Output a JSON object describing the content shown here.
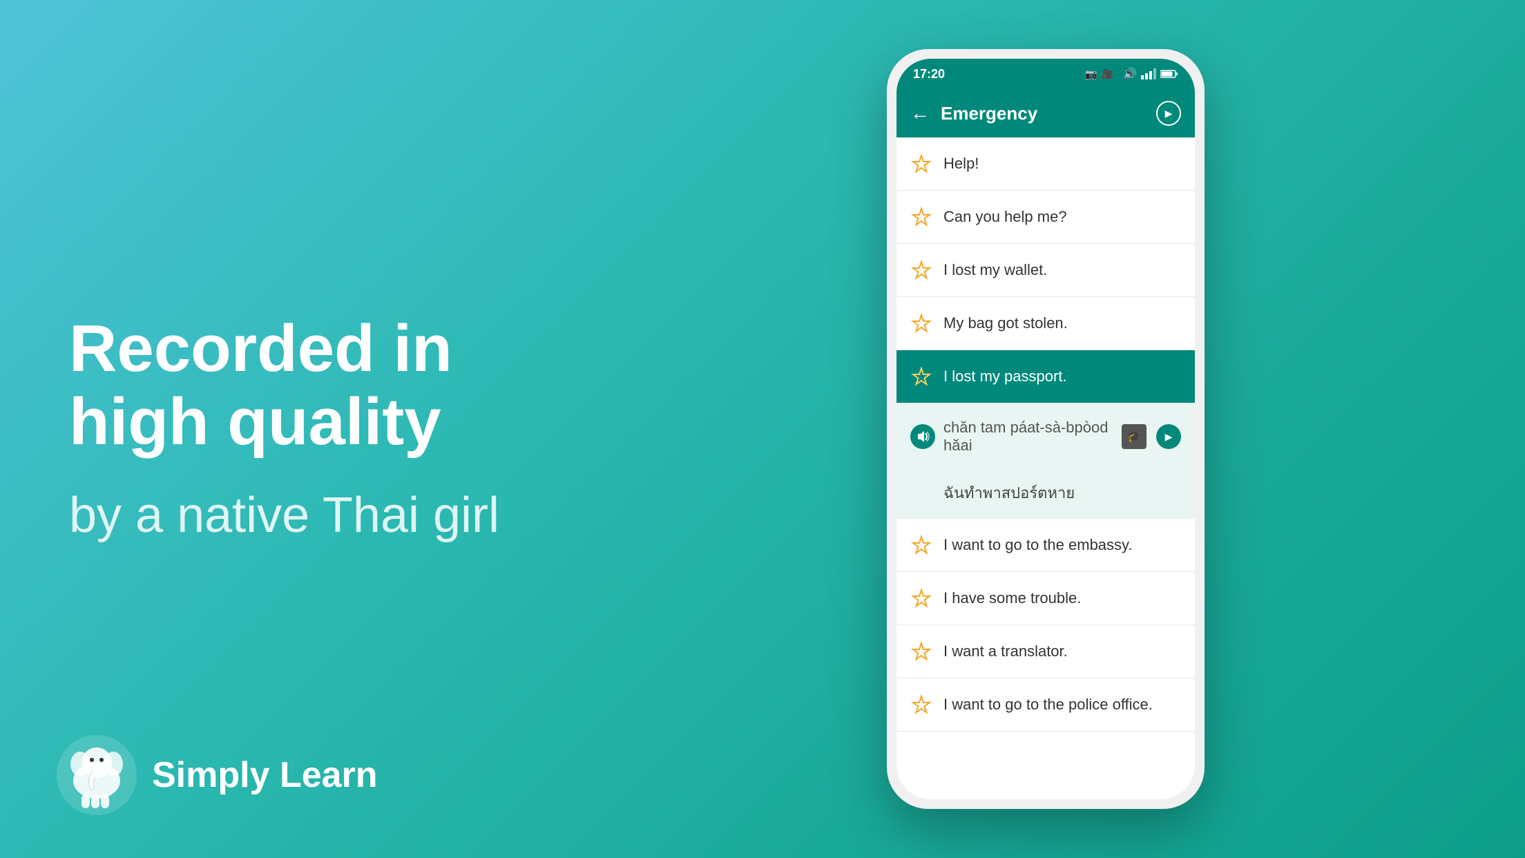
{
  "background": {
    "gradient_start": "#4fc3d8",
    "gradient_end": "#0d9e8a"
  },
  "left_panel": {
    "main_title": "Recorded in\nhigh quality",
    "subtitle": "by a native Thai girl",
    "logo_text": "Simply Learn"
  },
  "phone": {
    "status_bar": {
      "time": "17:20"
    },
    "header": {
      "title": "Emergency",
      "back_label": "←",
      "play_label": "▶"
    },
    "phrases": [
      {
        "id": 1,
        "text": "Help!",
        "starred": true,
        "active": false
      },
      {
        "id": 2,
        "text": "Can you help me?",
        "starred": true,
        "active": false
      },
      {
        "id": 3,
        "text": "I lost my wallet.",
        "starred": true,
        "active": false
      },
      {
        "id": 4,
        "text": "My bag got stolen.",
        "starred": true,
        "active": false
      },
      {
        "id": 5,
        "text": "I lost my passport.",
        "starred": true,
        "active": true
      },
      {
        "id": 6,
        "pronunciation": "chăn tam páat-sà-bpòod hăai",
        "thai": "ฉันทำพาสปอร์ตหาย",
        "expanded": true
      },
      {
        "id": 7,
        "text": "I want to go to the embassy.",
        "starred": true,
        "active": false
      },
      {
        "id": 8,
        "text": "I have some trouble.",
        "starred": true,
        "active": false
      },
      {
        "id": 9,
        "text": "I want a translator.",
        "starred": true,
        "active": false
      },
      {
        "id": 10,
        "text": "I want to go to the police office.",
        "starred": true,
        "active": false
      }
    ]
  }
}
